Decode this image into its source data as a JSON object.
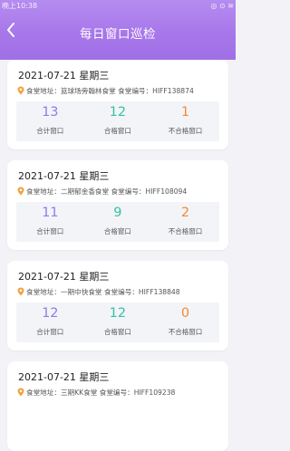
{
  "status_bar": {
    "time": "晚上10:38",
    "right": "◎ ⊙ ≋"
  },
  "header": {
    "title": "每日窗口巡检",
    "back_icon": "chevron-left-icon"
  },
  "colors": {
    "total": "#8f7ce8",
    "pass": "#35c1a5",
    "fail": "#f08a3a",
    "pin": "#f2a23c"
  },
  "cards": [
    {
      "date": "2021-07-21 星期三",
      "address_label": "食堂地址：",
      "address": "篮球场旁翰林食堂",
      "code_label": "食堂编号：",
      "code": "HIFF138874",
      "stats": [
        {
          "value": "13",
          "label": "合计窗口"
        },
        {
          "value": "12",
          "label": "合格窗口"
        },
        {
          "value": "1",
          "label": "不合格窗口"
        }
      ]
    },
    {
      "date": "2021-07-21 星期三",
      "address_label": "食堂地址：",
      "address": "二期郁金香食堂",
      "code_label": "食堂编号：",
      "code": "HIFF108094",
      "stats": [
        {
          "value": "11",
          "label": "合计窗口"
        },
        {
          "value": "9",
          "label": "合格窗口"
        },
        {
          "value": "2",
          "label": "不合格窗口"
        }
      ]
    },
    {
      "date": "2021-07-21 星期三",
      "address_label": "食堂地址：",
      "address": "一期中快食堂",
      "code_label": "食堂编号：",
      "code": "HIFF138848",
      "stats": [
        {
          "value": "12",
          "label": "合计窗口"
        },
        {
          "value": "12",
          "label": "合格窗口"
        },
        {
          "value": "0",
          "label": "不合格窗口"
        }
      ]
    },
    {
      "date": "2021-07-21 星期三",
      "address_label": "食堂地址：",
      "address": "三期KK食堂",
      "code_label": "食堂编号：",
      "code": "HIFF109238",
      "stats": []
    }
  ]
}
